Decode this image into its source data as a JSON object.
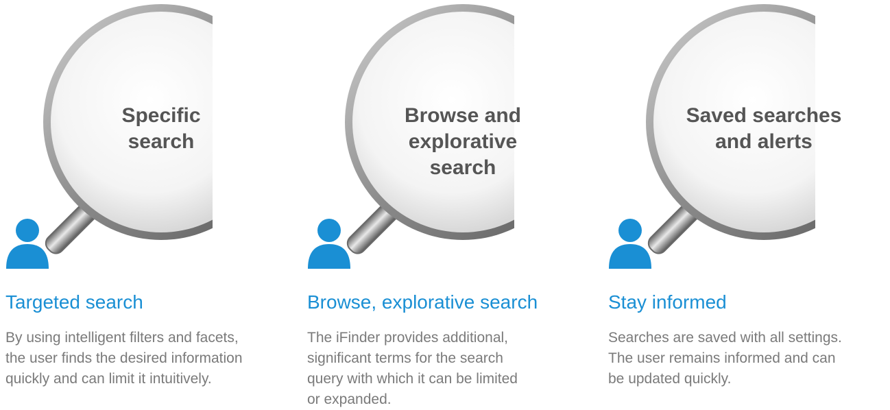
{
  "features": [
    {
      "lens_label": "Specific\nsearch",
      "title": "Targeted search",
      "description": "By using intelligent filters and facets,\nthe user finds the desired information\nquickly and can limit it intuitively."
    },
    {
      "lens_label": "Browse and\nexplorative search",
      "title": "Browse, explorative search",
      "description": "The iFinder provides additional,\nsignificant terms for the search\nquery with which it can be limited\nor expanded."
    },
    {
      "lens_label": "Saved searches\nand alerts",
      "title": "Stay informed",
      "description": "Searches are saved with all settings.\nThe user remains informed and can\nbe updated quickly."
    }
  ],
  "icons": {
    "magnifier": "magnifying-glass-icon",
    "user": "user-icon"
  },
  "colors": {
    "accent": "#1a8fd4",
    "lens_text": "#555555",
    "body_text": "#7a7a7a",
    "user_icon": "#1a8fd4"
  }
}
